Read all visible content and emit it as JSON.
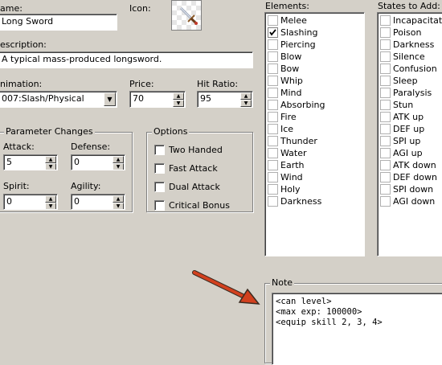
{
  "name": {
    "label": "ame:",
    "value": "Long Sword"
  },
  "icon": {
    "label": "Icon:"
  },
  "description": {
    "label": "escription:",
    "value": "A typical mass-produced longsword."
  },
  "animation": {
    "label": "nimation:",
    "value": "007:Slash/Physical"
  },
  "price": {
    "label": "Price:",
    "value": "70"
  },
  "hit_ratio": {
    "label": "Hit Ratio:",
    "value": "95"
  },
  "params": {
    "title": "Parameter Changes",
    "attack": {
      "label": "Attack:",
      "value": "5"
    },
    "defense": {
      "label": "Defense:",
      "value": "0"
    },
    "spirit": {
      "label": "Spirit:",
      "value": "0"
    },
    "agility": {
      "label": "Agility:",
      "value": "0"
    }
  },
  "options": {
    "title": "Options",
    "items": [
      {
        "label": "Two Handed",
        "checked": false
      },
      {
        "label": "Fast Attack",
        "checked": false
      },
      {
        "label": "Dual Attack",
        "checked": false
      },
      {
        "label": "Critical Bonus",
        "checked": false
      }
    ]
  },
  "elements": {
    "title": "Elements:",
    "items": [
      {
        "label": "Melee",
        "checked": false
      },
      {
        "label": "Slashing",
        "checked": true
      },
      {
        "label": "Piercing",
        "checked": false
      },
      {
        "label": "Blow",
        "checked": false
      },
      {
        "label": "Bow",
        "checked": false
      },
      {
        "label": "Whip",
        "checked": false
      },
      {
        "label": "Mind",
        "checked": false
      },
      {
        "label": "Absorbing",
        "checked": false
      },
      {
        "label": "Fire",
        "checked": false
      },
      {
        "label": "Ice",
        "checked": false
      },
      {
        "label": "Thunder",
        "checked": false
      },
      {
        "label": "Water",
        "checked": false
      },
      {
        "label": "Earth",
        "checked": false
      },
      {
        "label": "Wind",
        "checked": false
      },
      {
        "label": "Holy",
        "checked": false
      },
      {
        "label": "Darkness",
        "checked": false
      }
    ]
  },
  "states": {
    "title": "States to Add:",
    "items": [
      {
        "label": "Incapacitat",
        "checked": false
      },
      {
        "label": "Poison",
        "checked": false
      },
      {
        "label": "Darkness",
        "checked": false
      },
      {
        "label": "Silence",
        "checked": false
      },
      {
        "label": "Confusion",
        "checked": false
      },
      {
        "label": "Sleep",
        "checked": false
      },
      {
        "label": "Paralysis",
        "checked": false
      },
      {
        "label": "Stun",
        "checked": false
      },
      {
        "label": "ATK up",
        "checked": false
      },
      {
        "label": "DEF up",
        "checked": false
      },
      {
        "label": "SPI up",
        "checked": false
      },
      {
        "label": "AGI up",
        "checked": false
      },
      {
        "label": "ATK down",
        "checked": false
      },
      {
        "label": "DEF down",
        "checked": false
      },
      {
        "label": "SPI down",
        "checked": false
      },
      {
        "label": "AGI down",
        "checked": false
      }
    ]
  },
  "note": {
    "title": "Note",
    "lines": [
      "<can level>",
      "<max exp: 100000>",
      "<equip skill 2, 3, 4>"
    ]
  },
  "colors": {
    "arrow": "#d2401e",
    "checkmark": "#000000"
  }
}
